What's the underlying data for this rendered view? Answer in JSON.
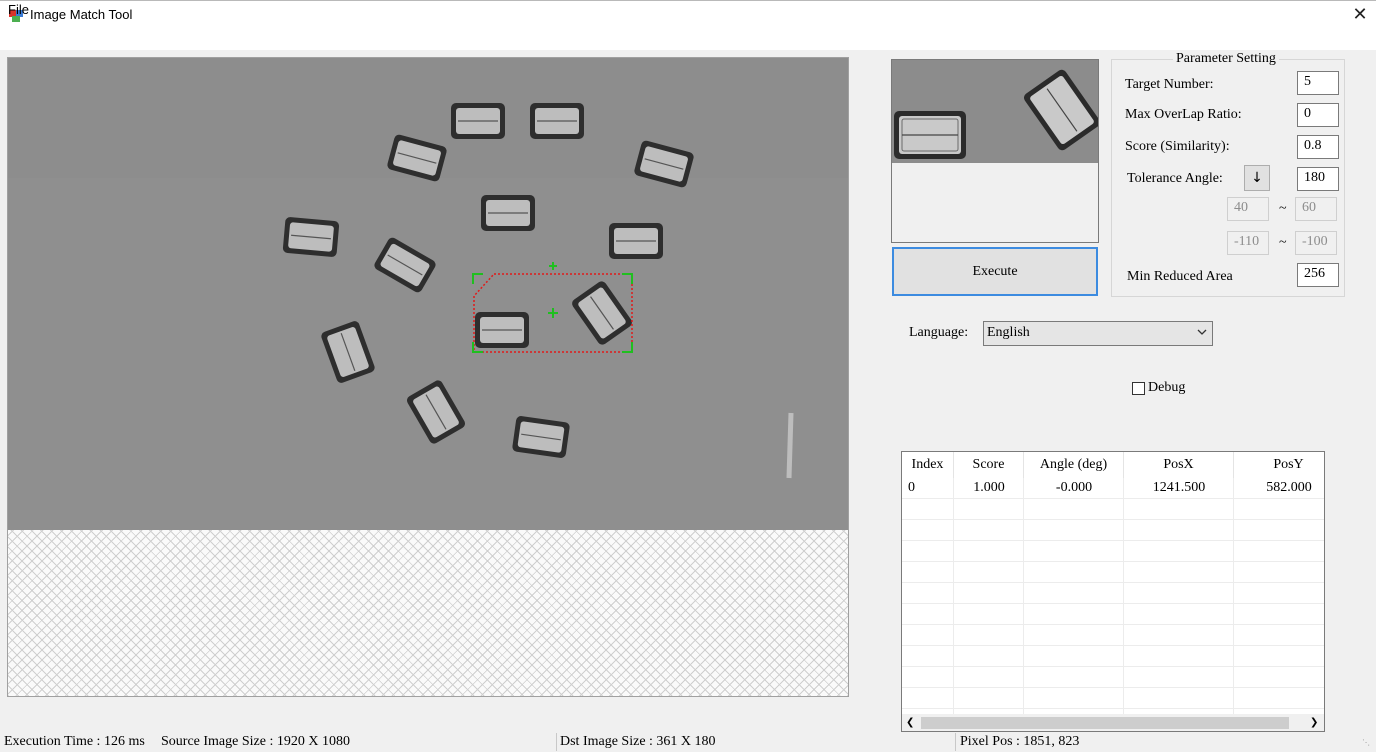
{
  "window": {
    "title": "Image Match Tool",
    "close_glyph": "✕"
  },
  "menu": {
    "file": "File"
  },
  "parameters": {
    "legend": "Parameter Setting",
    "target_number": {
      "label": "Target Number:",
      "value": "5"
    },
    "max_overlap": {
      "label": "Max OverLap Ratio:",
      "value": "0"
    },
    "score": {
      "label": "Score (Similarity):",
      "value": "0.8"
    },
    "tolerance_angle": {
      "label": "Tolerance Angle:",
      "button": "↓",
      "value": "180"
    },
    "range1": {
      "from": "40",
      "sep": "~",
      "to": "60"
    },
    "range2": {
      "from": "-110",
      "sep": "~",
      "to": "-100"
    },
    "min_reduced_area": {
      "label": "Min Reduced Area",
      "value": "256"
    }
  },
  "execute_button": "Execute",
  "language": {
    "label": "Language:",
    "selected": "English"
  },
  "debug": {
    "label": "Debug",
    "checked": false
  },
  "results": {
    "columns": [
      "Index",
      "Score",
      "Angle (deg)",
      "PosX",
      "PosY"
    ],
    "rows": [
      [
        "0",
        "1.000",
        "-0.000",
        "1241.500",
        "582.000"
      ]
    ]
  },
  "status": {
    "execution_time": "Execution Time : 126 ms",
    "source_size": "Source Image Size : 1920 X 1080",
    "dst_size": "Dst Image Size : 361 X 180",
    "pixel_pos": "Pixel Pos : 1851, 823"
  },
  "colors": {
    "accent": "#3c8be0",
    "match_box": "#1fbf1f",
    "match_outline": "#e01a1a"
  },
  "icons": {
    "app": "app-cube-icon",
    "close": "close-icon",
    "dropdown": "chevron-down-icon",
    "scroll_left": "arrow-left-icon",
    "scroll_right": "arrow-right-icon"
  }
}
